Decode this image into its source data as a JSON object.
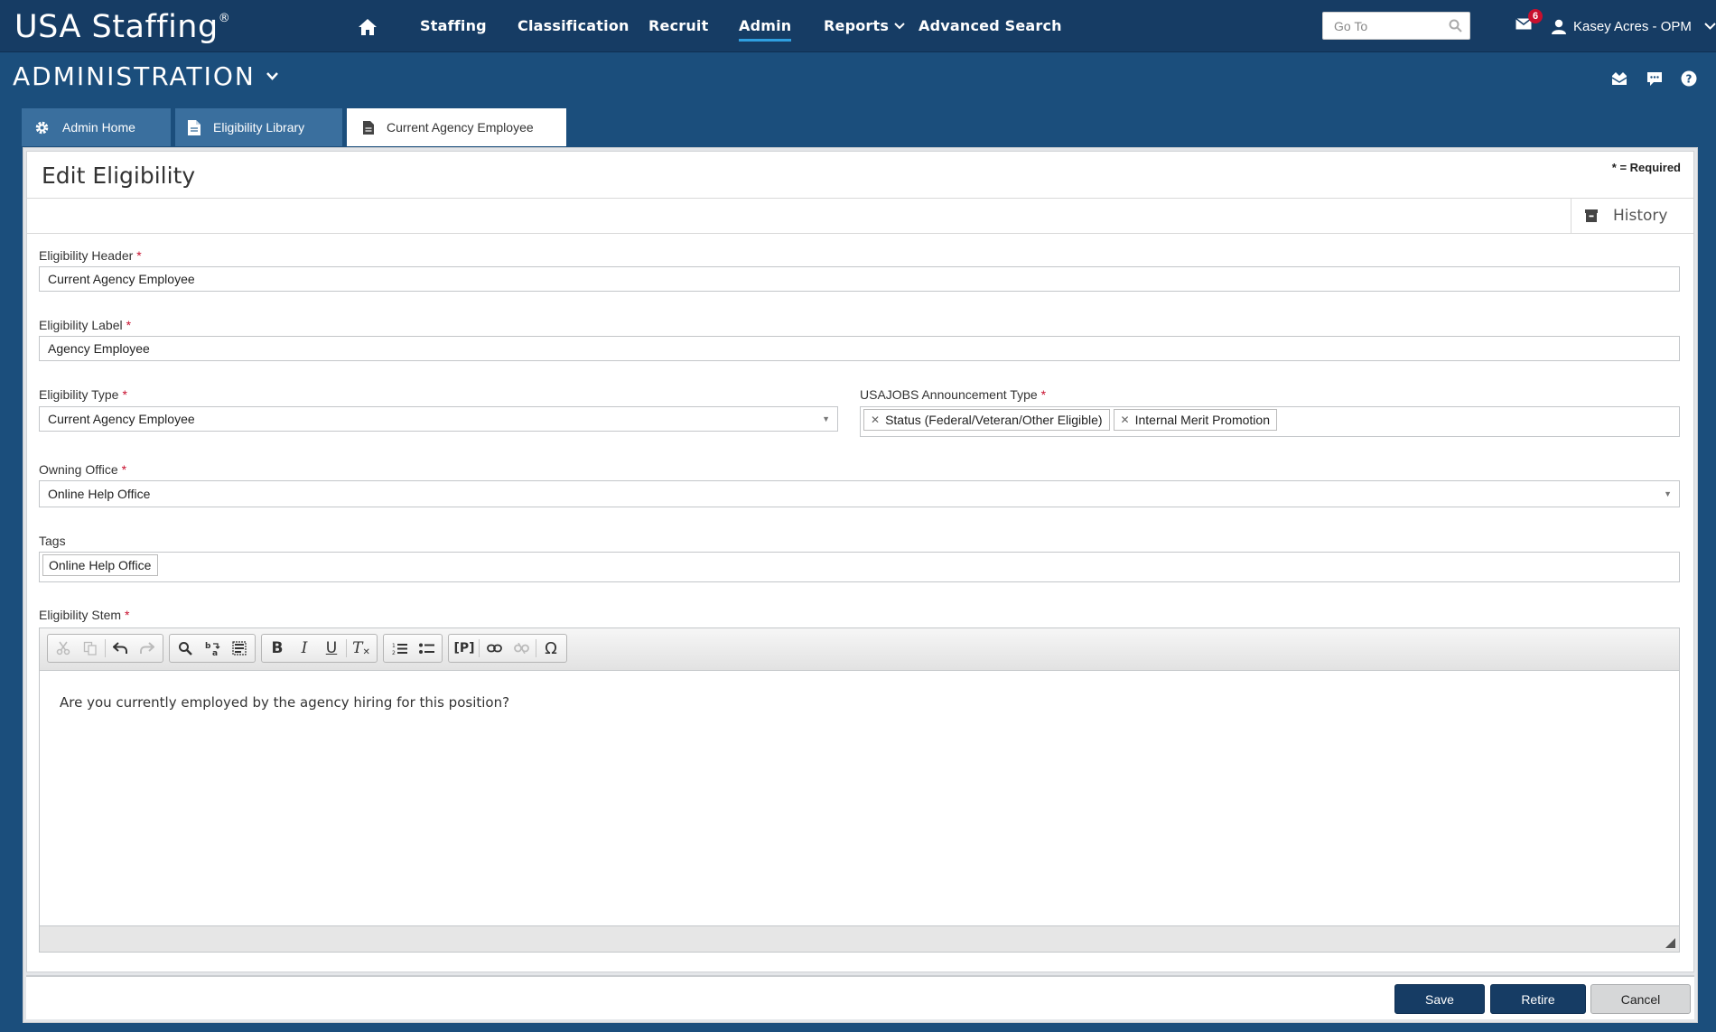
{
  "header": {
    "logo": "USA Staffing",
    "logo_mark": "®",
    "nav": [
      "Staffing",
      "Classification",
      "Recruit",
      "Admin",
      "Reports",
      "Advanced Search"
    ],
    "goto_placeholder": "Go To",
    "mail_count": "6",
    "user": "Kasey Acres - OPM"
  },
  "section": {
    "title": "ADMINISTRATION"
  },
  "tabs": [
    "Admin Home",
    "Eligibility Library",
    "Current Agency Employee"
  ],
  "form": {
    "title": "Edit Eligibility",
    "required_note": "* = Required",
    "history_label": "History",
    "eligibility_header": {
      "label": "Eligibility Header",
      "value": "Current Agency Employee"
    },
    "eligibility_label": {
      "label": "Eligibility Label",
      "value": "Agency Employee"
    },
    "eligibility_type": {
      "label": "Eligibility Type",
      "value": "Current Agency Employee"
    },
    "announcement_type": {
      "label": "USAJOBS Announcement Type",
      "values": [
        "Status (Federal/Veteran/Other Eligible)",
        "Internal Merit Promotion"
      ]
    },
    "owning_office": {
      "label": "Owning Office",
      "value": "Online Help Office"
    },
    "tags": {
      "label": "Tags",
      "values": [
        "Online Help Office"
      ]
    },
    "stem": {
      "label": "Eligibility Stem",
      "text": "Are you currently employed by the agency hiring for this position?"
    },
    "required_marker": "*"
  },
  "editor_toolbar": {
    "bold": "B",
    "italic": "I",
    "underline": "U",
    "clear_format": "T",
    "paragraph": "[P]",
    "special_char": "Ω"
  },
  "actions": {
    "save": "Save",
    "retire": "Retire",
    "cancel": "Cancel"
  },
  "colors": {
    "navy": "#163c64",
    "header_blue": "#1b4e7c",
    "tab_blue": "#3a6f9e",
    "required_red": "#c8102e",
    "active_underline": "#2f9fe0"
  }
}
